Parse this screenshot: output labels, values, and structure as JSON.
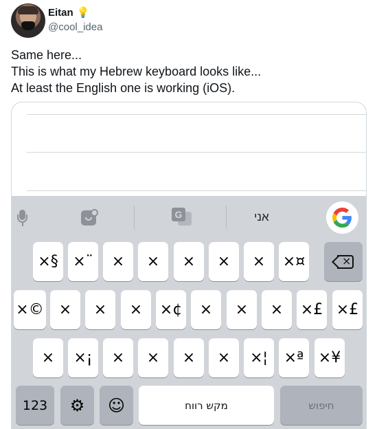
{
  "author": {
    "name": "Eitan",
    "name_emoji": "💡",
    "handle": "@cool_idea"
  },
  "tweet": {
    "lines": [
      "Same here...",
      "This is what my Hebrew keyboard looks like...",
      "At least the English one is working (iOS)."
    ]
  },
  "keyboard": {
    "toolbar": {
      "icons": [
        "mic-icon",
        "sticker-search-icon",
        "translate-icon",
        "google-icon"
      ],
      "translate_glyph": "G",
      "suggestion": "אני"
    },
    "row1": [
      "×§",
      "×¨",
      "×",
      "×",
      "×",
      "×",
      "×",
      "×¤"
    ],
    "row2": [
      "×©",
      "×",
      "×",
      "×",
      "×¢",
      "×",
      "×",
      "×",
      "×£"
    ],
    "row3": [
      "×",
      "×¡",
      "×",
      "×",
      "×",
      "×",
      "×¦",
      "×ª",
      "×¥"
    ],
    "bottom": {
      "numbers_label": "123",
      "settings_icon": "gear-icon",
      "emoji_icon": "smiley-icon",
      "space_label": "מקש רווח",
      "search_label": "חיפוש"
    },
    "colors": {
      "keyboard_bg": "#d1d4d9",
      "key_bg": "#ffffff",
      "dark_key_bg": "#aeb3bc"
    }
  }
}
